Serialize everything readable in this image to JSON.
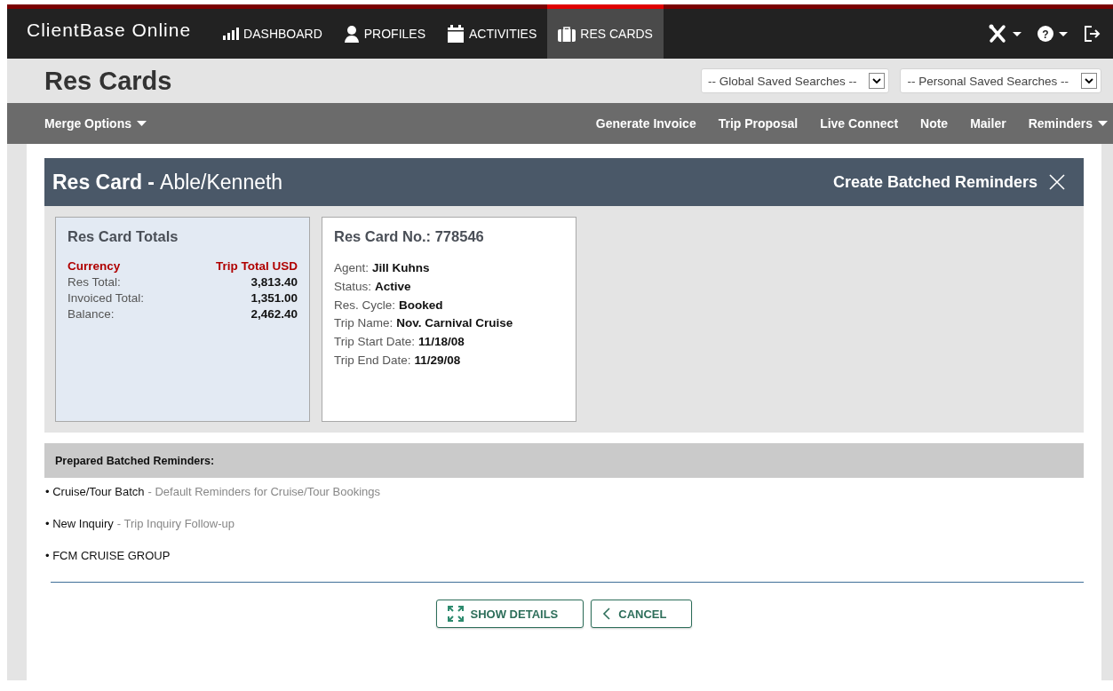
{
  "app": {
    "title": "ClientBase Online"
  },
  "nav_tabs": [
    {
      "label": "DASHBOARD",
      "kind": "chart",
      "selected": false
    },
    {
      "label": "PROFILES",
      "kind": "person",
      "selected": false
    },
    {
      "label": "ACTIVITIES",
      "kind": "calendar",
      "selected": false
    },
    {
      "label": "RES CARDS",
      "kind": "suitcase",
      "selected": true
    }
  ],
  "help_menu": {
    "label": "?"
  },
  "page": {
    "title": "Res Cards"
  },
  "saved_searches": [
    {
      "value": "-- Global Saved Searches --"
    },
    {
      "value": "-- Personal Saved Searches --"
    }
  ],
  "toolbar": {
    "left": [
      {
        "label": "Merge Options",
        "dropdown": true
      }
    ],
    "right": [
      {
        "label": "Generate Invoice",
        "dropdown": false
      },
      {
        "label": "Trip Proposal",
        "dropdown": false
      },
      {
        "label": "Live Connect",
        "dropdown": false
      },
      {
        "label": "Note",
        "dropdown": false
      },
      {
        "label": "Mailer",
        "dropdown": false
      },
      {
        "label": "Reminders",
        "dropdown": true
      }
    ]
  },
  "panel": {
    "title": "Res Card -",
    "subtitle": "Able/Kenneth",
    "action": "Create Batched Reminders"
  },
  "totals": {
    "title": "Res Card Totals",
    "header": [
      "Currency",
      "Trip Total USD"
    ],
    "rows": [
      {
        "label": "Res Total:",
        "value": "3,813.40"
      },
      {
        "label": "Invoiced Total:",
        "value": "1,351.00"
      },
      {
        "label": "Balance:",
        "value": "2,462.40"
      }
    ]
  },
  "details": {
    "title": "Res Card No.: 778546",
    "fields": [
      {
        "label": "Agent:",
        "value": "Jill Kuhns"
      },
      {
        "label": "Status:",
        "value": "Active"
      },
      {
        "label": "Res. Cycle:",
        "value": "Booked"
      },
      {
        "label": "Trip Name:",
        "value": "Nov. Carnival Cruise"
      },
      {
        "label": "Trip Start Date:",
        "value": "11/18/08"
      },
      {
        "label": "Trip End Date:",
        "value": "11/29/08"
      }
    ]
  },
  "reminders": {
    "heading": "Prepared Batched Reminders:",
    "items": [
      {
        "name": "• Cruise/Tour Batch",
        "detail": "- Default Reminders for Cruise/Tour Bookings"
      },
      {
        "name": "• New Inquiry",
        "detail": "- Trip Inquiry Follow-up"
      },
      {
        "name": "• FCM CRUISE GROUP"
      }
    ]
  },
  "buttons": [
    {
      "label": "SHOW DETAILS",
      "kind": "expand"
    },
    {
      "label": "CANCEL",
      "kind": "back"
    }
  ]
}
